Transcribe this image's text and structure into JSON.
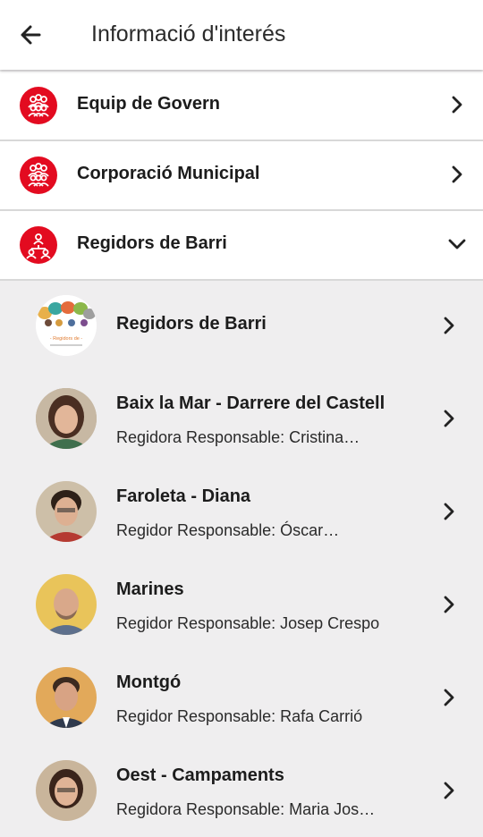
{
  "header": {
    "title": "Informació d'interés",
    "back_icon": "arrow-left-icon"
  },
  "accent_color": "#e30b20",
  "sections": [
    {
      "label": "Equip de Govern",
      "icon": "group-icon",
      "chevron": "chevron-right-icon"
    },
    {
      "label": "Corporació Municipal",
      "icon": "group-icon",
      "chevron": "chevron-right-icon"
    },
    {
      "label": "Regidors de Barri",
      "icon": "network-icon",
      "chevron": "chevron-down-icon",
      "expanded": true
    }
  ],
  "subitems": [
    {
      "title": "Regidors de Barri",
      "subtitle": "",
      "avatar": "regidors-logo",
      "logo_text": "- Regidors de -"
    },
    {
      "title": "Baix la Mar - Darrere del Castell",
      "subtitle": "Regidora Responsable: Cristina…",
      "avatar": "photo"
    },
    {
      "title": "Faroleta - Diana",
      "subtitle": "Regidor Responsable: Óscar…",
      "avatar": "photo"
    },
    {
      "title": "Marines",
      "subtitle": "Regidor Responsable: Josep Crespo",
      "avatar": "photo"
    },
    {
      "title": "Montgó",
      "subtitle": "Regidor Responsable: Rafa Carrió",
      "avatar": "photo"
    },
    {
      "title": "Oest - Campaments",
      "subtitle": "Regidora Responsable: Maria Jos…",
      "avatar": "photo"
    }
  ]
}
